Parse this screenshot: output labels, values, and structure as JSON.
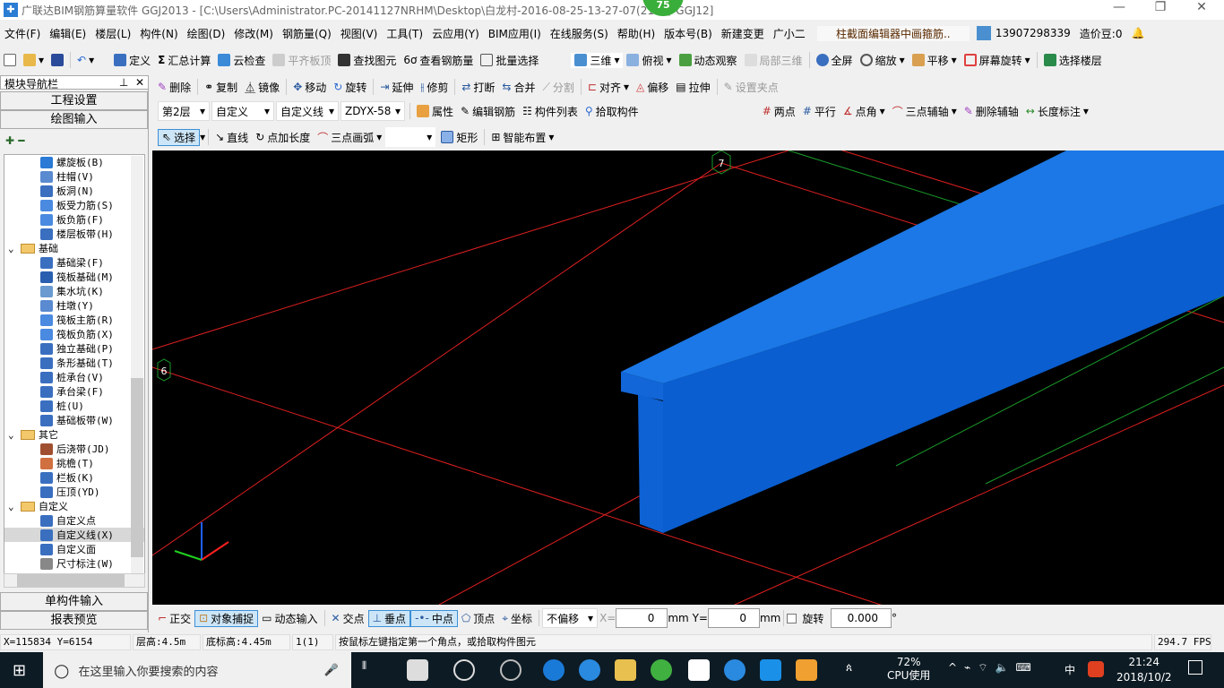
{
  "title": "广联达BIM钢筋算量软件 GGJ2013 - [C:\\Users\\Administrator.PC-20141127NRHM\\Desktop\\白龙村-2016-08-25-13-27-07(2165)-GGJ12]",
  "badge": "75",
  "menu": [
    "文件(F)",
    "编辑(E)",
    "楼层(L)",
    "构件(N)",
    "绘图(D)",
    "修改(M)",
    "钢筋量(Q)",
    "视图(V)",
    "工具(T)",
    "云应用(Y)",
    "BIM应用(I)",
    "在线服务(S)",
    "帮助(H)",
    "版本号(B)",
    "新建变更",
    "广小二"
  ],
  "notice": "柱截面编辑器中画箍筋..",
  "user": {
    "phone": "13907298339",
    "beans": "造价豆:0"
  },
  "toolbar1": [
    "定义",
    "汇总计算",
    "云检查",
    "平齐板顶",
    "查找图元",
    "查看钢筋量",
    "批量选择"
  ],
  "toolbar1_right": [
    "三维",
    "俯视",
    "动态观察",
    "局部三维",
    "全屏",
    "缩放",
    "平移",
    "屏幕旋转",
    "选择楼层"
  ],
  "toolbar2": [
    "删除",
    "复制",
    "镜像",
    "移动",
    "旋转",
    "延伸",
    "修剪",
    "打断",
    "合并",
    "分割",
    "对齐",
    "偏移",
    "拉伸",
    "设置夹点"
  ],
  "selects": [
    "第2层",
    "自定义",
    "自定义线",
    "ZDYX-58"
  ],
  "toolbar3": [
    "属性",
    "编辑钢筋",
    "构件列表",
    "拾取构件"
  ],
  "toolbar3_right": [
    "两点",
    "平行",
    "点角",
    "三点辅轴",
    "删除辅轴",
    "长度标注"
  ],
  "toolbar4": [
    "选择",
    "直线",
    "点加长度",
    "三点画弧",
    "矩形",
    "智能布置"
  ],
  "sidebar": {
    "title": "模块导航栏",
    "nav": [
      "工程设置",
      "绘图输入"
    ],
    "bottom": [
      "单构件输入",
      "报表预览"
    ],
    "tree": [
      {
        "t": "螺旋板(B)",
        "c": "#2a7ad6"
      },
      {
        "t": "柱帽(V)",
        "c": "#5a8ad0"
      },
      {
        "t": "板洞(N)",
        "c": "#3a6fc0"
      },
      {
        "t": "板受力筋(S)",
        "c": "#4a8ae0"
      },
      {
        "t": "板负筋(F)",
        "c": "#4a8ae0"
      },
      {
        "t": "楼层板带(H)",
        "c": "#3a6fc0"
      },
      {
        "g": "基础"
      },
      {
        "t": "基础梁(F)",
        "c": "#3a6fc0"
      },
      {
        "t": "筏板基础(M)",
        "c": "#2a5fb0"
      },
      {
        "t": "集水坑(K)",
        "c": "#6a9ad0"
      },
      {
        "t": "柱墩(Y)",
        "c": "#5a8ad0"
      },
      {
        "t": "筏板主筋(R)",
        "c": "#4a8ae0"
      },
      {
        "t": "筏板负筋(X)",
        "c": "#4a8ae0"
      },
      {
        "t": "独立基础(P)",
        "c": "#3a6fc0"
      },
      {
        "t": "条形基础(T)",
        "c": "#3a6fc0"
      },
      {
        "t": "桩承台(V)",
        "c": "#3a6fc0"
      },
      {
        "t": "承台梁(F)",
        "c": "#3a6fc0"
      },
      {
        "t": "桩(U)",
        "c": "#3a6fc0"
      },
      {
        "t": "基础板带(W)",
        "c": "#3a6fc0"
      },
      {
        "g": "其它"
      },
      {
        "t": "后浇带(JD)",
        "c": "#a05030"
      },
      {
        "t": "挑檐(T)",
        "c": "#d07040"
      },
      {
        "t": "栏板(K)",
        "c": "#3a6fc0"
      },
      {
        "t": "压顶(YD)",
        "c": "#3a6fc0"
      },
      {
        "g": "自定义"
      },
      {
        "t": "自定义点",
        "c": "#3a6fc0"
      },
      {
        "t": "自定义线(X)",
        "c": "#3a6fc0",
        "sel": true
      },
      {
        "t": "自定义面",
        "c": "#3a6fc0"
      },
      {
        "t": "尺寸标注(W)",
        "c": "#888"
      }
    ]
  },
  "axes": [
    "6",
    "7"
  ],
  "snap": [
    "正交",
    "对象捕捉",
    "动态输入",
    "交点",
    "垂点",
    "中点",
    "顶点",
    "坐标"
  ],
  "offset": {
    "mode": "不偏移",
    "x_label": "X=",
    "x": "0",
    "y_label": "Y=",
    "y": "0",
    "unit": "mm",
    "rotate": "旋转",
    "angle": "0.000",
    "deg": "°"
  },
  "status": {
    "coords": "X=115834 Y=6154",
    "floor_h": "层高:4.5m",
    "base_h": "底标高:4.45m",
    "count": "1(1)",
    "hint": "按鼠标左键指定第一个角点，或拾取构件图元",
    "fps": "294.7 FPS"
  },
  "taskbar": {
    "search": "在这里输入你要搜索的内容",
    "cpu": "72%",
    "cpu_label": "CPU使用",
    "ime": "中",
    "time": "21:24",
    "date": "2018/10/2"
  },
  "colors": {
    "beam_top": "#1b78e6",
    "beam_side": "#0a62d6",
    "grid_red": "#e02020",
    "grid_green": "#1a9a2a"
  }
}
